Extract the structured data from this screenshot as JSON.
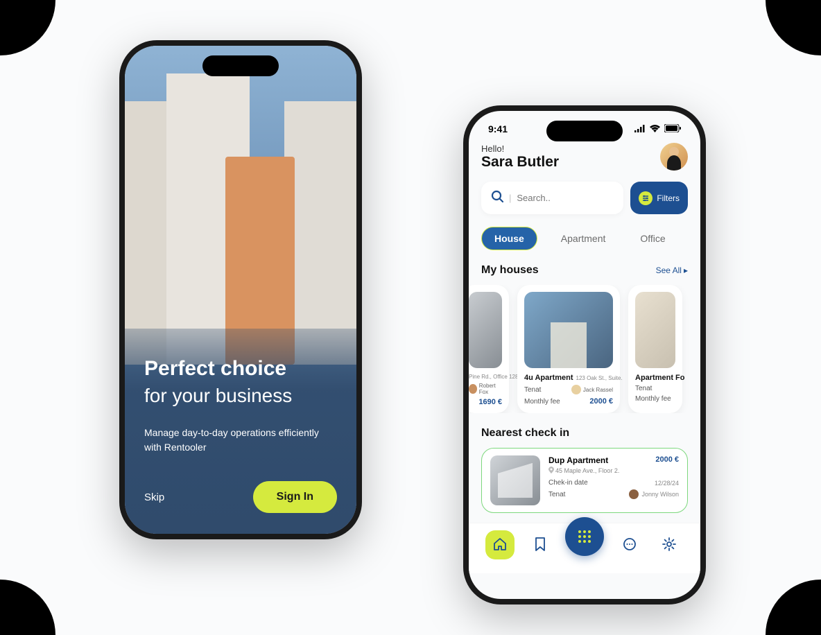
{
  "onboarding": {
    "title": "Perfect choice",
    "subtitle": "for your business",
    "description": "Manage day-to-day operations efficiently with Rentooler",
    "skip": "Skip",
    "signin": "Sign In"
  },
  "home": {
    "status_time": "9:41",
    "greeting_hello": "Hello!",
    "greeting_name": "Sara Butler",
    "search_placeholder": "Search..",
    "filters_label": "Filters",
    "tabs": {
      "house": "House",
      "apartment": "Apartment",
      "office": "Office"
    },
    "my_houses_title": "My houses",
    "see_all": "See All",
    "cards": {
      "left": {
        "addr": "Pine Rd., Office 128.",
        "tenant_name": "Robert Fox",
        "price": "1690 €"
      },
      "main": {
        "name": "4u Apartment",
        "addr": "123 Oak St., Suite.",
        "tenant_label": "Tenat",
        "tenant_name": "Jack Rassel",
        "fee_label": "Monthly fee",
        "price": "2000 €"
      },
      "right": {
        "name": "Apartment Fo",
        "tenant_label": "Tenat",
        "fee_label": "Monthly fee"
      }
    },
    "nearest_title": "Nearest check in",
    "checkin": {
      "name": "Dup Apartment",
      "price": "2000 €",
      "addr": "45 Maple Ave., Floor 2.",
      "checkin_label": "Chek-in date",
      "date": "12/28/24",
      "tenant_label": "Tenat",
      "tenant_name": "Jonny Wilson"
    }
  }
}
